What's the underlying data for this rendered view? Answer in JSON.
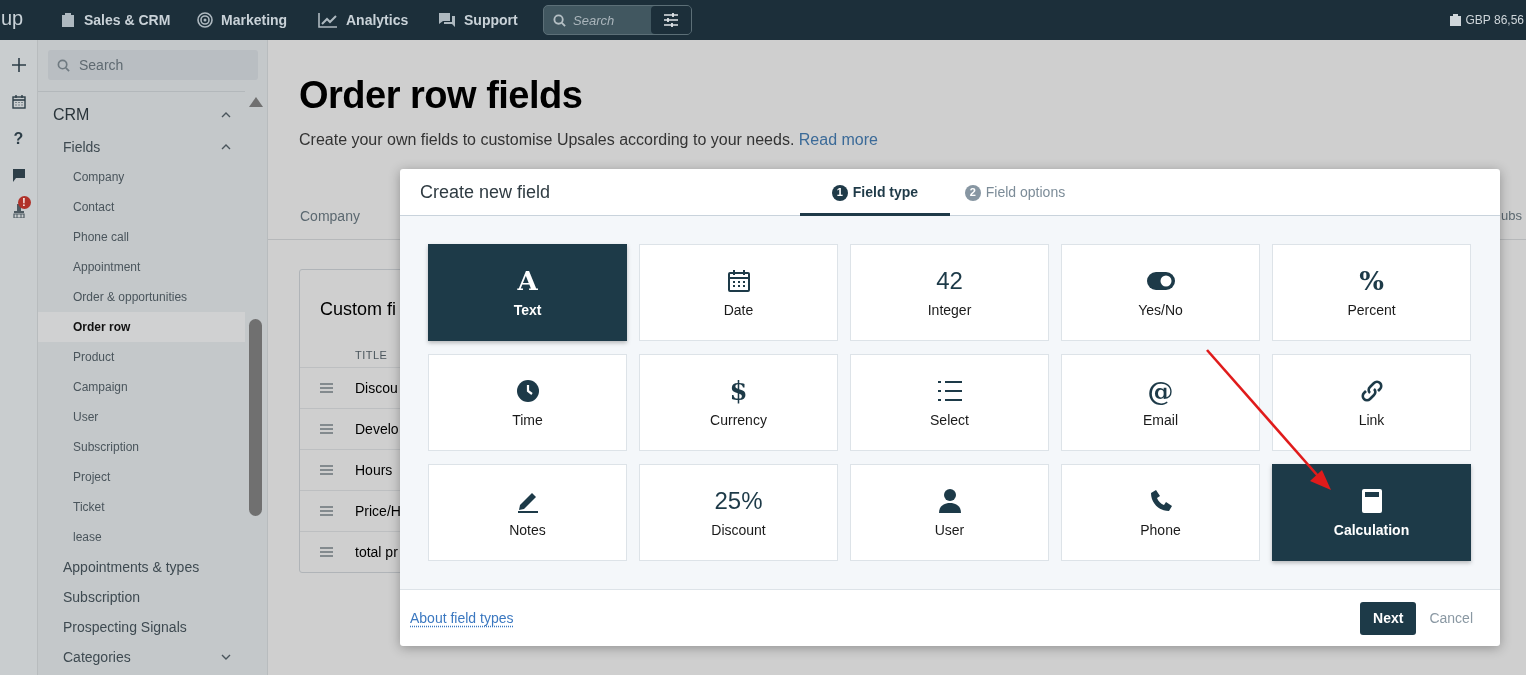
{
  "topbar": {
    "logo": "up",
    "nav": [
      {
        "label": "Sales & CRM"
      },
      {
        "label": "Marketing"
      },
      {
        "label": "Analytics"
      },
      {
        "label": "Support"
      }
    ],
    "search": {
      "placeholder": "Search"
    },
    "balance": "GBP 86,56"
  },
  "rail": {
    "help": "?",
    "badge": "!"
  },
  "sidebar": {
    "search": {
      "placeholder": "Search"
    },
    "items": [
      {
        "label": "CRM",
        "expanded": true,
        "children": [
          {
            "label": "Fields",
            "expanded": true,
            "children": [
              {
                "label": "Company",
                "selected": false
              },
              {
                "label": "Contact",
                "selected": false
              },
              {
                "label": "Phone call",
                "selected": false
              },
              {
                "label": "Appointment",
                "selected": false
              },
              {
                "label": "Order & opportunities",
                "selected": false
              },
              {
                "label": "Order row",
                "selected": true
              },
              {
                "label": "Product",
                "selected": false
              },
              {
                "label": "Campaign",
                "selected": false
              },
              {
                "label": "User",
                "selected": false
              },
              {
                "label": "Subscription",
                "selected": false
              },
              {
                "label": "Project",
                "selected": false
              },
              {
                "label": "Ticket",
                "selected": false
              },
              {
                "label": "lease",
                "selected": false
              }
            ]
          },
          {
            "label": "Appointments & types"
          },
          {
            "label": "Subscription"
          },
          {
            "label": "Prospecting Signals"
          },
          {
            "label": "Categories",
            "expanded": false
          }
        ]
      }
    ]
  },
  "page": {
    "title": "Order row fields",
    "subtitle": "Create your own fields to customise Upsales according to your needs.",
    "link": "Read more",
    "tabs": [
      {
        "label": "Company"
      },
      {
        "label": "ubs"
      }
    ],
    "card": {
      "title": "Custom fi",
      "column": "TITLE",
      "rows": [
        "Discou",
        "Develo",
        "Hours",
        "Price/H",
        "total pr"
      ]
    }
  },
  "modal": {
    "title": "Create new field",
    "steps": [
      {
        "number": "1",
        "label": "Field type",
        "selected": true
      },
      {
        "number": "2",
        "label": "Field options",
        "selected": false
      }
    ],
    "tiles": [
      {
        "label": "Text",
        "kind": "glyph",
        "glyph": "A",
        "selected": true
      },
      {
        "label": "Date",
        "kind": "icon",
        "selected": false
      },
      {
        "label": "Integer",
        "kind": "glyph",
        "glyph": "42",
        "selected": false
      },
      {
        "label": "Yes/No",
        "kind": "icon",
        "selected": false
      },
      {
        "label": "Percent",
        "kind": "glyph",
        "glyph": "%",
        "selected": false
      },
      {
        "label": "Time",
        "kind": "icon",
        "selected": false
      },
      {
        "label": "Currency",
        "kind": "glyph",
        "glyph": "$",
        "selected": false
      },
      {
        "label": "Select",
        "kind": "icon",
        "selected": false
      },
      {
        "label": "Email",
        "kind": "glyph",
        "glyph": "@",
        "selected": false
      },
      {
        "label": "Link",
        "kind": "icon",
        "selected": false
      },
      {
        "label": "Notes",
        "kind": "icon",
        "selected": false
      },
      {
        "label": "Discount",
        "kind": "glyph",
        "glyph": "25%",
        "selected": false
      },
      {
        "label": "User",
        "kind": "icon",
        "selected": false
      },
      {
        "label": "Phone",
        "kind": "icon",
        "selected": false
      },
      {
        "label": "Calculation",
        "kind": "icon",
        "selected": true
      }
    ],
    "footer": {
      "link": "About field types",
      "buttons": [
        {
          "label": "Next",
          "kind": "primary"
        },
        {
          "label": "Cancel",
          "kind": "plain"
        }
      ]
    }
  }
}
